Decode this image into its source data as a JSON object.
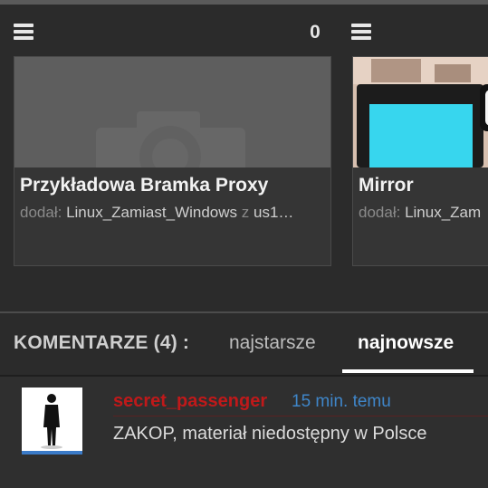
{
  "header": {
    "menu_icon": "hamburger-menu-icon",
    "count": "0"
  },
  "cards": [
    {
      "title": "Przykładowa Bramka Proxy",
      "added_by_label": "dodał:",
      "user": "Linux_Zamiast_Windows",
      "via": "z",
      "site": "us1…"
    },
    {
      "title": "Mirror",
      "added_by_label": "dodał:",
      "user": "Linux_Zam"
    }
  ],
  "comments": {
    "label": "KOMENTARZE (4) :",
    "tabs": [
      {
        "label": "najstarsze"
      },
      {
        "label": "najnowsze",
        "active": true
      }
    ],
    "items": [
      {
        "user": "secret_passenger",
        "time": "15 min. temu",
        "text": "ZAKOP, materiał niedostępny w Polsce"
      }
    ]
  },
  "colors": {
    "background": "#2b2b2b",
    "username": "#c0191a",
    "timestamp": "#3f86c9",
    "avatar_bar": "#3b7bc8"
  }
}
